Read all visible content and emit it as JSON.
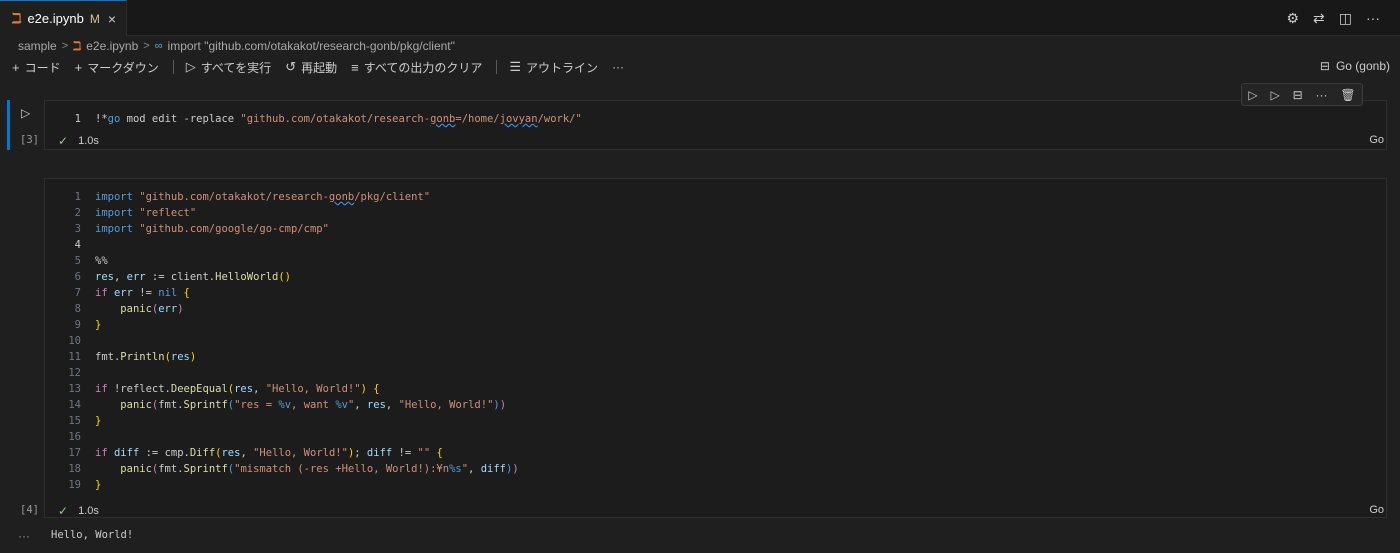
{
  "tab": {
    "icon": "notebook-icon",
    "label": "e2e.ipynb",
    "modified": "M",
    "close": "×"
  },
  "tab_actions": [
    "settings-icon",
    "compare-icon",
    "split-editor-icon",
    "more-icon"
  ],
  "breadcrumb": {
    "folder": "sample",
    "file": "e2e.ipynb",
    "symbol": "import \"github.com/otakakot/research-gonb/pkg/client\""
  },
  "toolbar": {
    "add_code": "コード",
    "add_markdown": "マークダウン",
    "run_all": "すべてを実行",
    "restart": "再起動",
    "clear_outputs": "すべての出力のクリア",
    "outline": "アウトライン",
    "more": "···"
  },
  "kernel": {
    "label": "Go (gonb)"
  },
  "cell_toolbar": [
    "run-above-icon",
    "run-below-icon",
    "split-cell-icon",
    "more-icon",
    "delete-icon"
  ],
  "cells": [
    {
      "exec_count": "[3]",
      "status": "1.0s",
      "language": "Go",
      "lines": [
        "1"
      ],
      "code_text": "!*go mod edit -replace \"github.com/otakakot/research-gonb=/home/jovyan/work/\""
    },
    {
      "exec_count": "[4]",
      "status": "1.0s",
      "language": "Go",
      "lines": [
        "1",
        "2",
        "3",
        "4",
        "5",
        "6",
        "7",
        "8",
        "9",
        "10",
        "11",
        "12",
        "13",
        "14",
        "15",
        "16",
        "17",
        "18",
        "19"
      ],
      "code_text": [
        "import \"github.com/otakakot/research-gonb/pkg/client\"",
        "import \"reflect\"",
        "import \"github.com/google/go-cmp/cmp\"",
        "",
        "%%",
        "res, err := client.HelloWorld()",
        "if err != nil {",
        "    panic(err)",
        "}",
        "",
        "fmt.Println(res)",
        "",
        "if !reflect.DeepEqual(res, \"Hello, World!\") {",
        "    panic(fmt.Sprintf(\"res = %v, want %v\", res, \"Hello, World!\"))",
        "}",
        "",
        "if diff := cmp.Diff(res, \"Hello, World!\"); diff != \"\" {",
        "    panic(fmt.Sprintf(\"mismatch (-res +Hello, World!):¥n%s\", diff))",
        "}"
      ],
      "output": "Hello, World!"
    }
  ],
  "output_more": "···"
}
